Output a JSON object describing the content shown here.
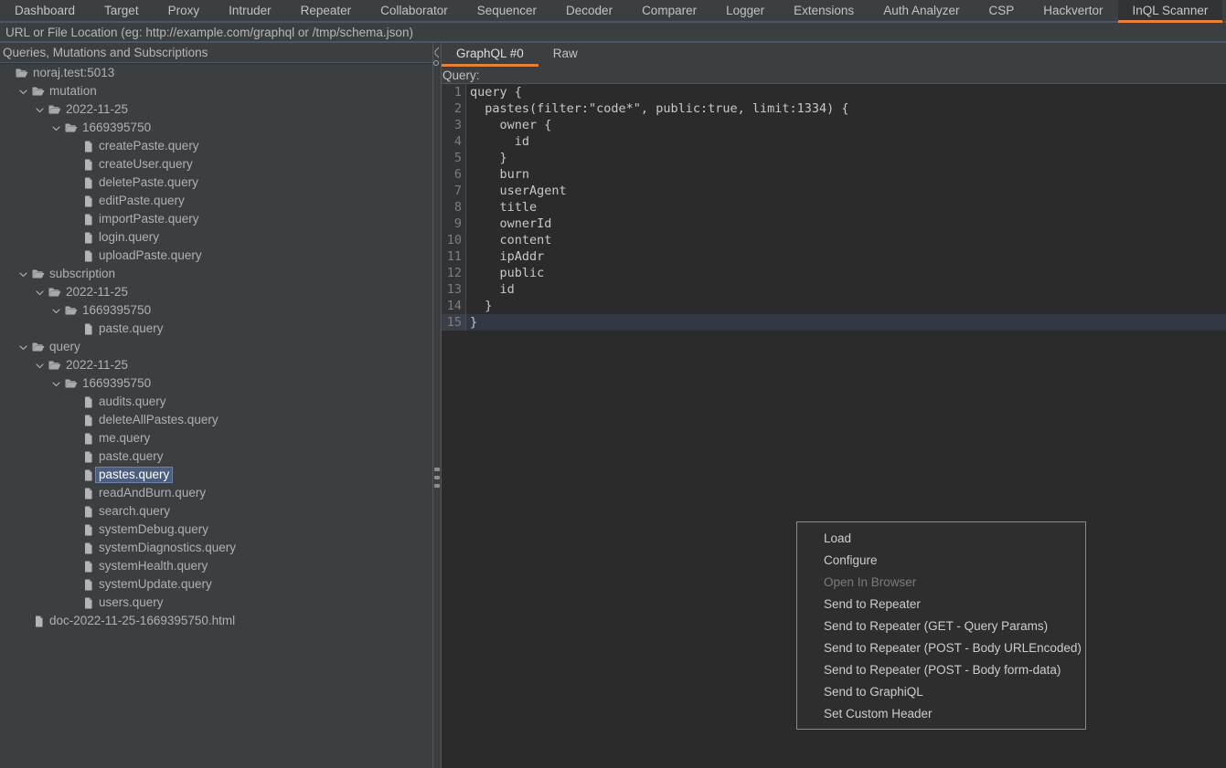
{
  "app": {
    "tabs": [
      {
        "label": "Dashboard",
        "active": false
      },
      {
        "label": "Target",
        "active": false
      },
      {
        "label": "Proxy",
        "active": false
      },
      {
        "label": "Intruder",
        "active": false
      },
      {
        "label": "Repeater",
        "active": false
      },
      {
        "label": "Collaborator",
        "active": false
      },
      {
        "label": "Sequencer",
        "active": false
      },
      {
        "label": "Decoder",
        "active": false
      },
      {
        "label": "Comparer",
        "active": false
      },
      {
        "label": "Logger",
        "active": false
      },
      {
        "label": "Extensions",
        "active": false
      },
      {
        "label": "Auth Analyzer",
        "active": false
      },
      {
        "label": "CSP",
        "active": false
      },
      {
        "label": "Hackvertor",
        "active": false
      },
      {
        "label": "InQL Scanner",
        "active": true
      }
    ],
    "accent_color": "#e8803a",
    "background_color": "#3c3f41",
    "editor_background_color": "#2b2b2b",
    "selection_color": "#4b5e7e"
  },
  "url_bar": {
    "value": "",
    "placeholder": "URL or File Location (eg: http://example.com/graphql or /tmp/schema.json)"
  },
  "tree": {
    "header": "Queries, Mutations and Subscriptions",
    "rows": [
      {
        "indent": 0,
        "twisty": "none",
        "icon": "folder-icon",
        "label": "noraj.test:5013",
        "selected": false
      },
      {
        "indent": 1,
        "twisty": "expanded",
        "icon": "folder-icon",
        "label": "mutation",
        "selected": false
      },
      {
        "indent": 2,
        "twisty": "expanded",
        "icon": "folder-icon",
        "label": "2022-11-25",
        "selected": false
      },
      {
        "indent": 3,
        "twisty": "expanded",
        "icon": "folder-icon",
        "label": "1669395750",
        "selected": false
      },
      {
        "indent": 4,
        "twisty": "none",
        "icon": "file-icon",
        "label": "createPaste.query",
        "selected": false
      },
      {
        "indent": 4,
        "twisty": "none",
        "icon": "file-icon",
        "label": "createUser.query",
        "selected": false
      },
      {
        "indent": 4,
        "twisty": "none",
        "icon": "file-icon",
        "label": "deletePaste.query",
        "selected": false
      },
      {
        "indent": 4,
        "twisty": "none",
        "icon": "file-icon",
        "label": "editPaste.query",
        "selected": false
      },
      {
        "indent": 4,
        "twisty": "none",
        "icon": "file-icon",
        "label": "importPaste.query",
        "selected": false
      },
      {
        "indent": 4,
        "twisty": "none",
        "icon": "file-icon",
        "label": "login.query",
        "selected": false
      },
      {
        "indent": 4,
        "twisty": "none",
        "icon": "file-icon",
        "label": "uploadPaste.query",
        "selected": false
      },
      {
        "indent": 1,
        "twisty": "expanded",
        "icon": "folder-icon",
        "label": "subscription",
        "selected": false
      },
      {
        "indent": 2,
        "twisty": "expanded",
        "icon": "folder-icon",
        "label": "2022-11-25",
        "selected": false
      },
      {
        "indent": 3,
        "twisty": "expanded",
        "icon": "folder-icon",
        "label": "1669395750",
        "selected": false
      },
      {
        "indent": 4,
        "twisty": "none",
        "icon": "file-icon",
        "label": "paste.query",
        "selected": false
      },
      {
        "indent": 1,
        "twisty": "expanded",
        "icon": "folder-icon",
        "label": "query",
        "selected": false
      },
      {
        "indent": 2,
        "twisty": "expanded",
        "icon": "folder-icon",
        "label": "2022-11-25",
        "selected": false
      },
      {
        "indent": 3,
        "twisty": "expanded",
        "icon": "folder-icon",
        "label": "1669395750",
        "selected": false
      },
      {
        "indent": 4,
        "twisty": "none",
        "icon": "file-icon",
        "label": "audits.query",
        "selected": false
      },
      {
        "indent": 4,
        "twisty": "none",
        "icon": "file-icon",
        "label": "deleteAllPastes.query",
        "selected": false
      },
      {
        "indent": 4,
        "twisty": "none",
        "icon": "file-icon",
        "label": "me.query",
        "selected": false
      },
      {
        "indent": 4,
        "twisty": "none",
        "icon": "file-icon",
        "label": "paste.query",
        "selected": false
      },
      {
        "indent": 4,
        "twisty": "none",
        "icon": "file-icon",
        "label": "pastes.query",
        "selected": true
      },
      {
        "indent": 4,
        "twisty": "none",
        "icon": "file-icon",
        "label": "readAndBurn.query",
        "selected": false
      },
      {
        "indent": 4,
        "twisty": "none",
        "icon": "file-icon",
        "label": "search.query",
        "selected": false
      },
      {
        "indent": 4,
        "twisty": "none",
        "icon": "file-icon",
        "label": "systemDebug.query",
        "selected": false
      },
      {
        "indent": 4,
        "twisty": "none",
        "icon": "file-icon",
        "label": "systemDiagnostics.query",
        "selected": false
      },
      {
        "indent": 4,
        "twisty": "none",
        "icon": "file-icon",
        "label": "systemHealth.query",
        "selected": false
      },
      {
        "indent": 4,
        "twisty": "none",
        "icon": "file-icon",
        "label": "systemUpdate.query",
        "selected": false
      },
      {
        "indent": 4,
        "twisty": "none",
        "icon": "file-icon",
        "label": "users.query",
        "selected": false
      },
      {
        "indent": 1,
        "twisty": "none",
        "icon": "file-icon",
        "label": "doc-2022-11-25-1669395750.html",
        "selected": false
      }
    ]
  },
  "editor": {
    "tabs": [
      {
        "label": "GraphQL #0",
        "active": true
      },
      {
        "label": "Raw",
        "active": false
      }
    ],
    "query_label": "Query:",
    "code_lines": [
      {
        "n": "1",
        "text": "query {",
        "current": false
      },
      {
        "n": "2",
        "text": "  pastes(filter:\"code*\", public:true, limit:1334) {",
        "current": false
      },
      {
        "n": "3",
        "text": "    owner {",
        "current": false
      },
      {
        "n": "4",
        "text": "      id",
        "current": false
      },
      {
        "n": "5",
        "text": "    }",
        "current": false
      },
      {
        "n": "6",
        "text": "    burn",
        "current": false
      },
      {
        "n": "7",
        "text": "    userAgent",
        "current": false
      },
      {
        "n": "8",
        "text": "    title",
        "current": false
      },
      {
        "n": "9",
        "text": "    ownerId",
        "current": false
      },
      {
        "n": "10",
        "text": "    content",
        "current": false
      },
      {
        "n": "11",
        "text": "    ipAddr",
        "current": false
      },
      {
        "n": "12",
        "text": "    public",
        "current": false
      },
      {
        "n": "13",
        "text": "    id",
        "current": false
      },
      {
        "n": "14",
        "text": "  }",
        "current": false
      },
      {
        "n": "15",
        "text": "}",
        "current": true
      }
    ]
  },
  "context_menu": {
    "items": [
      {
        "label": "Load",
        "disabled": false
      },
      {
        "label": "Configure",
        "disabled": false
      },
      {
        "label": "Open In Browser",
        "disabled": true
      },
      {
        "label": "Send to Repeater",
        "disabled": false
      },
      {
        "label": "Send to Repeater (GET - Query Params)",
        "disabled": false
      },
      {
        "label": "Send to Repeater (POST - Body URLEncoded)",
        "disabled": false
      },
      {
        "label": "Send to Repeater (POST - Body form-data)",
        "disabled": false
      },
      {
        "label": "Send to GraphiQL",
        "disabled": false
      },
      {
        "label": "Set Custom Header",
        "disabled": false
      }
    ]
  }
}
